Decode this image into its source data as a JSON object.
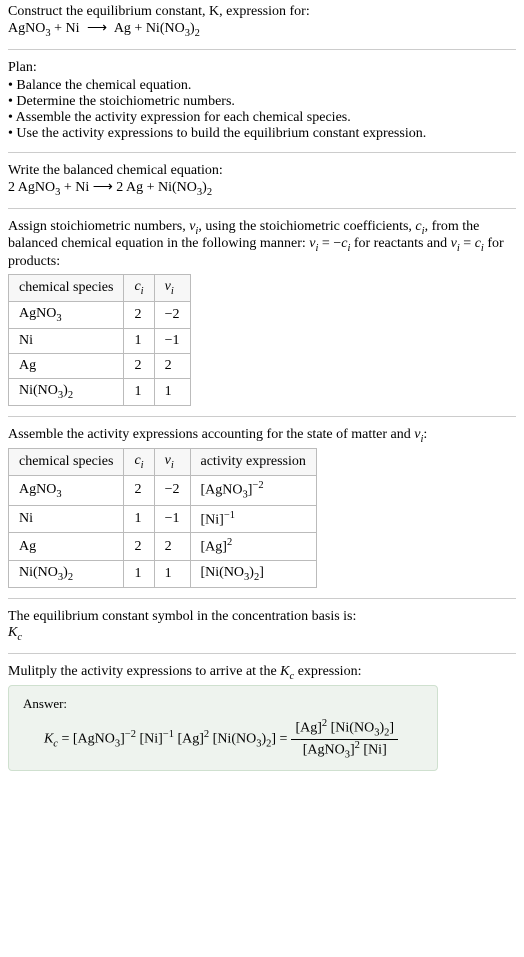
{
  "title": "Construct the equilibrium constant, K, expression for:",
  "equation_unbalanced": {
    "lhs": "AgNO",
    "lhs_sub": "3",
    "plus1": " + Ni",
    "arrow": "⟶",
    "rhs": "Ag + Ni(NO",
    "rhs_sub": "3",
    "rhs_close": ")",
    "rhs_sub2": "2"
  },
  "plan_heading": "Plan:",
  "plan_items": [
    "Balance the chemical equation.",
    "Determine the stoichiometric numbers.",
    "Assemble the activity expression for each chemical species.",
    "Use the activity expressions to build the equilibrium constant expression."
  ],
  "balanced_heading": "Write the balanced chemical equation:",
  "balanced": {
    "text_pre": "2 AgNO",
    "sub1": "3",
    "mid": " + Ni  ⟶  2 Ag + Ni(NO",
    "sub2": "3",
    "close": ")",
    "sub3": "2"
  },
  "stoich_heading_1": "Assign stoichiometric numbers, ",
  "stoich_nu": "ν",
  "stoich_i": "i",
  "stoich_heading_2": ", using the stoichiometric coefficients, ",
  "stoich_c": "c",
  "stoich_heading_3": ", from the balanced chemical equation in the following manner: ",
  "stoich_eq1_a": "ν",
  "stoich_eq1_b": "i",
  "stoich_eq1_c": " = −",
  "stoich_eq1_d": "c",
  "stoich_eq1_e": "i",
  "stoich_heading_4": " for reactants and ",
  "stoich_eq2_a": "ν",
  "stoich_eq2_b": "i",
  "stoich_eq2_c": " = ",
  "stoich_eq2_d": "c",
  "stoich_eq2_e": "i",
  "stoich_heading_5": " for products:",
  "table1": {
    "h1": "chemical species",
    "h2": "c",
    "h2sub": "i",
    "h3": "ν",
    "h3sub": "i",
    "rows": [
      {
        "species_pre": "AgNO",
        "species_sub": "3",
        "species_post": "",
        "c": "2",
        "nu": "−2"
      },
      {
        "species_pre": "Ni",
        "species_sub": "",
        "species_post": "",
        "c": "1",
        "nu": "−1"
      },
      {
        "species_pre": "Ag",
        "species_sub": "",
        "species_post": "",
        "c": "2",
        "nu": "2"
      },
      {
        "species_pre": "Ni(NO",
        "species_sub": "3",
        "species_post": ")",
        "species_sub2": "2",
        "c": "1",
        "nu": "1"
      }
    ]
  },
  "activity_heading_1": "Assemble the activity expressions accounting for the state of matter and ",
  "activity_heading_nu": "ν",
  "activity_heading_i": "i",
  "activity_heading_2": ":",
  "table2": {
    "h1": "chemical species",
    "h2": "c",
    "h2sub": "i",
    "h3": "ν",
    "h3sub": "i",
    "h4": "activity expression",
    "rows": [
      {
        "sp_pre": "AgNO",
        "sp_sub": "3",
        "sp_post": "",
        "c": "2",
        "nu": "−2",
        "act_pre": "[AgNO",
        "act_sub": "3",
        "act_post": "]",
        "act_sup": "−2"
      },
      {
        "sp_pre": "Ni",
        "sp_sub": "",
        "sp_post": "",
        "c": "1",
        "nu": "−1",
        "act_pre": "[Ni]",
        "act_sub": "",
        "act_post": "",
        "act_sup": "−1"
      },
      {
        "sp_pre": "Ag",
        "sp_sub": "",
        "sp_post": "",
        "c": "2",
        "nu": "2",
        "act_pre": "[Ag]",
        "act_sub": "",
        "act_post": "",
        "act_sup": "2"
      },
      {
        "sp_pre": "Ni(NO",
        "sp_sub": "3",
        "sp_post": ")",
        "sp_sub2": "2",
        "c": "1",
        "nu": "1",
        "act_pre": "[Ni(NO",
        "act_sub": "3",
        "act_post": ")",
        "act_sub2": "2",
        "act_close": "]",
        "act_sup": ""
      }
    ]
  },
  "symbol_heading": "The equilibrium constant symbol in the concentration basis is:",
  "kc": "K",
  "kc_sub": "c",
  "multiply_heading": "Mulitply the activity expressions to arrive at the ",
  "multiply_heading_2": " expression:",
  "answer_label": "Answer:",
  "answer": {
    "lhs_k": "K",
    "lhs_sub": "c",
    "eq": " = ",
    "t1_pre": "[AgNO",
    "t1_sub": "3",
    "t1_post": "]",
    "t1_sup": "−2",
    "t2_pre": " [Ni]",
    "t2_sup": "−1",
    "t3_pre": " [Ag]",
    "t3_sup": "2",
    "t4_pre": " [Ni(NO",
    "t4_sub": "3",
    "t4_post": ")",
    "t4_sub2": "2",
    "t4_close": "]",
    "eq2": " = ",
    "num_a": "[Ag]",
    "num_a_sup": "2",
    "num_b": " [Ni(NO",
    "num_b_sub": "3",
    "num_b_post": ")",
    "num_b_sub2": "2",
    "num_b_close": "]",
    "den_a": "[AgNO",
    "den_a_sub": "3",
    "den_a_post": "]",
    "den_a_sup": "2",
    "den_b": " [Ni]"
  }
}
